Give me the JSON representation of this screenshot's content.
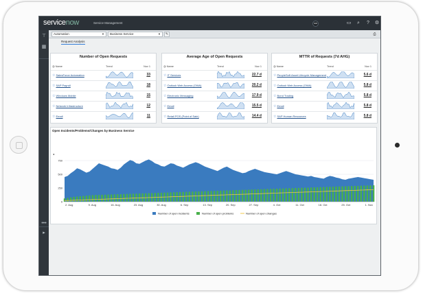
{
  "app": {
    "logo_service": "service",
    "logo_now": "now",
    "title": "Service Management",
    "user_initials": "SW"
  },
  "filters": {
    "group": "Automation",
    "service": "Business Service"
  },
  "tabs": {
    "active": "Request Analysis"
  },
  "panels": [
    {
      "title": "Number of Open Requests",
      "col_name": "Name",
      "col_trend": "Trend",
      "col_value": "Nov 1",
      "rows": [
        {
          "name": "SalesForce Automation",
          "value": "33"
        },
        {
          "name": "SAP Payroll",
          "value": "18"
        },
        {
          "name": "Windows Mobile",
          "value": "15"
        },
        {
          "name": "Network Infrastructure",
          "value": "12"
        },
        {
          "name": "Email",
          "value": "11"
        }
      ]
    },
    {
      "title": "Average Age of Open Requests",
      "col_name": "Name",
      "col_trend": "Trend",
      "col_value": "Nov 1",
      "rows": [
        {
          "name": "IT Services",
          "value": "22.7 d"
        },
        {
          "name": "Outlook Web Access (OWA)",
          "value": "20.2 d"
        },
        {
          "name": "Electronic Messaging",
          "value": "17.9 d"
        },
        {
          "name": "Email",
          "value": "15.5 d"
        },
        {
          "name": "Retail POS (Point of Sale)",
          "value": "14.4 d"
        }
      ]
    },
    {
      "title": "MTTR of Requests (7d AHG)",
      "col_name": "Name",
      "col_trend": "Trend",
      "col_value": "Nov 1",
      "rows": [
        {
          "name": "PeopleSoft Asset Lifecycle Management",
          "value": "5.6 d"
        },
        {
          "name": "Outlook Web Access (OWA)",
          "value": "5.8 d"
        },
        {
          "name": "Bond Trading",
          "value": "5.8 d"
        },
        {
          "name": "Email",
          "value": "5.8 d"
        },
        {
          "name": "SAP Human Resources",
          "value": "5.8 d"
        }
      ]
    }
  ],
  "chart_data": {
    "type": "area",
    "title": "Open Incidents/Problems/Changes by Business Service",
    "x_ticks": [
      "2. Aug",
      "9. Aug",
      "16. Aug",
      "23. Aug",
      "30. Aug",
      "6. Sep",
      "13. Sep",
      "20. Sep",
      "27. Sep",
      "4. Oct",
      "11. Oct",
      "18. Oct",
      "25. Oct",
      "1. Nov"
    ],
    "y_ticks": [
      "0",
      "250",
      "500",
      "750"
    ],
    "ylim": [
      0,
      1000
    ],
    "legend_position": "bottom",
    "series": [
      {
        "name": "Number of open incidents",
        "color": "#3a7bbf",
        "values": [
          450,
          470,
          520,
          560,
          610,
          590,
          560,
          530,
          550,
          600,
          650,
          700,
          680,
          660,
          640,
          610,
          600,
          580,
          620,
          680,
          720,
          760,
          740,
          700,
          690,
          720,
          750,
          770,
          740,
          700,
          680,
          650,
          640,
          670,
          700,
          690,
          660,
          640,
          620,
          650,
          680,
          700,
          720,
          700,
          670,
          640,
          620,
          600,
          580,
          560,
          590,
          620,
          640,
          610,
          580,
          560,
          540,
          520,
          530,
          560,
          580,
          600,
          580,
          560,
          540,
          530,
          520,
          510,
          500,
          520,
          540,
          560,
          540,
          520,
          500,
          490,
          480,
          470,
          460,
          470,
          450,
          440,
          430,
          420,
          450,
          470,
          460,
          440,
          430,
          410,
          400,
          420,
          430,
          440,
          450,
          440,
          430,
          420,
          410,
          400
        ]
      },
      {
        "name": "Number of open problems",
        "color": "#49b04b",
        "values": [
          60,
          70,
          80,
          90,
          95,
          100,
          105,
          110,
          115,
          120,
          122,
          124,
          126,
          128,
          130,
          132,
          134,
          136,
          138,
          140,
          142,
          144,
          146,
          148,
          150,
          152,
          154,
          156,
          158,
          160,
          162,
          164,
          166,
          168,
          170,
          172,
          174,
          176,
          178,
          180,
          182,
          184,
          186,
          188,
          190,
          192,
          194,
          196,
          198,
          200,
          202,
          204,
          206,
          208,
          210,
          212,
          214,
          216,
          218,
          220,
          222,
          224,
          226,
          228,
          230,
          232,
          234,
          236,
          238,
          240,
          242,
          244,
          246,
          248,
          250,
          252,
          254,
          256,
          258,
          260,
          262,
          264,
          266,
          268,
          270,
          272,
          274,
          276,
          278,
          280,
          282,
          284,
          286,
          288,
          290,
          292,
          294,
          296,
          298,
          300
        ]
      },
      {
        "name": "Number of open changes",
        "color": "#f2c94c",
        "values": [
          20,
          22,
          25,
          28,
          30,
          32,
          34,
          36,
          38,
          40,
          42,
          44,
          46,
          48,
          50,
          52,
          54,
          56,
          58,
          60,
          62,
          64,
          66,
          68,
          70,
          72,
          74,
          76,
          78,
          80,
          82,
          84,
          86,
          88,
          90,
          92,
          94,
          96,
          98,
          100,
          102,
          104,
          106,
          108,
          110,
          112,
          114,
          116,
          118,
          120,
          122,
          124,
          126,
          128,
          130,
          132,
          134,
          136,
          138,
          140,
          142,
          144,
          146,
          148,
          150,
          152,
          154,
          156,
          158,
          160,
          162,
          164,
          166,
          168,
          170,
          172,
          174,
          176,
          178,
          180,
          182,
          184,
          186,
          188,
          190,
          192,
          194,
          196,
          198,
          200,
          202,
          204,
          206,
          208,
          210,
          212,
          214,
          216,
          218,
          220
        ]
      }
    ]
  }
}
